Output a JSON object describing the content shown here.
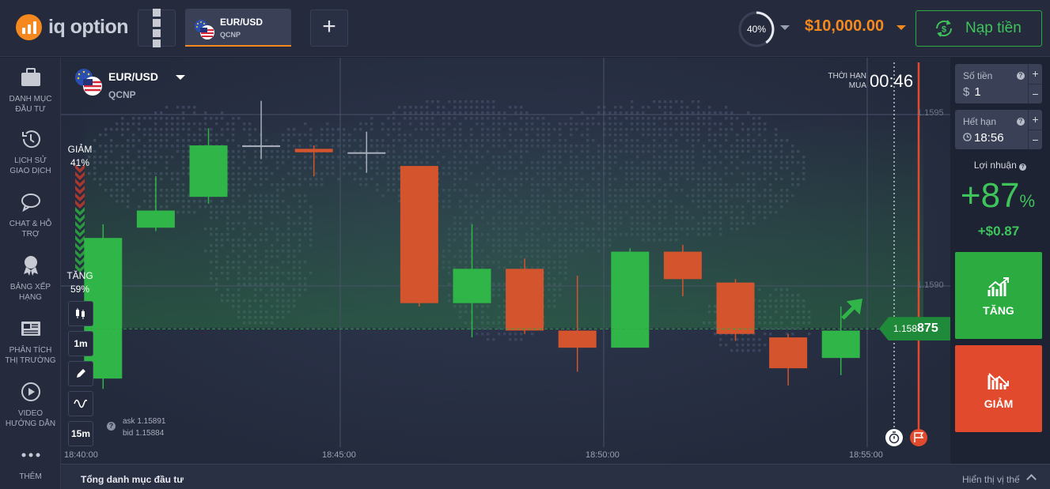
{
  "header": {
    "logo_text": "iq option",
    "asset_tab": {
      "pair": "EUR/USD",
      "type": "QCNP"
    },
    "payout_percent": "40%",
    "balance": "$10,000.00",
    "deposit_label": "Nạp tiền"
  },
  "sidebar": {
    "items": [
      {
        "label": "DANH MỤC ĐẦU TƯ",
        "icon": "briefcase-icon"
      },
      {
        "label": "LỊCH SỬ GIAO DỊCH",
        "icon": "history-icon"
      },
      {
        "label": "CHAT & HỖ TRỢ",
        "icon": "chat-icon"
      },
      {
        "label": "BẢNG XẾP HẠNG",
        "icon": "medal-icon"
      },
      {
        "label": "PHÂN TÍCH THỊ TRƯỜNG",
        "icon": "news-icon"
      },
      {
        "label": "VIDEO HƯỚNG DẪN",
        "icon": "play-icon"
      },
      {
        "label": "THÊM",
        "icon": "more-icon"
      }
    ]
  },
  "chart_panel": {
    "asset_name": "EUR/USD",
    "asset_type": "QCNP",
    "timer_label": "THỜI HẠN MUA",
    "timer_value": "00:46",
    "sentiment_down_label": "GIẢM",
    "sentiment_down_value": "41%",
    "sentiment_up_label": "TĂNG",
    "sentiment_up_value": "59%",
    "tools": [
      "1m",
      "15m"
    ],
    "ask": "ask 1.15891",
    "bid": "bid 1.15884",
    "current_price_prefix": "1.158",
    "current_price_suffix": "875"
  },
  "chart_data": {
    "type": "candlestick",
    "instrument": "EUR/USD",
    "y_tick_labels": [
      "1.1595",
      "1.1590"
    ],
    "x_tick_labels": [
      "18:40:00",
      "18:45:00",
      "18:50:00",
      "18:55:00"
    ],
    "ylim": [
      1.15833,
      1.15974
    ],
    "grid": true,
    "current_price": 1.158875,
    "candles": [
      {
        "time": "18:40:30",
        "open": 1.15873,
        "high": 1.15918,
        "low": 1.1587,
        "close": 1.15914,
        "color": "green"
      },
      {
        "time": "18:41:30",
        "open": 1.15917,
        "high": 1.15932,
        "low": 1.15916,
        "close": 1.15922,
        "color": "green"
      },
      {
        "time": "18:42:30",
        "open": 1.15926,
        "high": 1.15946,
        "low": 1.15924,
        "close": 1.15941,
        "color": "green"
      },
      {
        "time": "18:43:30",
        "open": 1.15941,
        "high": 1.15954,
        "low": 1.15937,
        "close": 1.15941,
        "color": "gray"
      },
      {
        "time": "18:44:30",
        "open": 1.1594,
        "high": 1.15941,
        "low": 1.15932,
        "close": 1.15939,
        "color": "red"
      },
      {
        "time": "18:45:30",
        "open": 1.15939,
        "high": 1.15945,
        "low": 1.15933,
        "close": 1.15939,
        "color": "gray"
      },
      {
        "time": "18:46:30",
        "open": 1.15935,
        "high": 1.15935,
        "low": 1.15894,
        "close": 1.15895,
        "color": "red"
      },
      {
        "time": "18:47:30",
        "open": 1.15895,
        "high": 1.15918,
        "low": 1.15885,
        "close": 1.15905,
        "color": "green"
      },
      {
        "time": "18:48:30",
        "open": 1.15905,
        "high": 1.15908,
        "low": 1.15886,
        "close": 1.15887,
        "color": "red"
      },
      {
        "time": "18:49:30",
        "open": 1.15887,
        "high": 1.15903,
        "low": 1.15875,
        "close": 1.15882,
        "color": "red"
      },
      {
        "time": "18:50:30",
        "open": 1.15882,
        "high": 1.15911,
        "low": 1.15882,
        "close": 1.1591,
        "color": "green"
      },
      {
        "time": "18:51:30",
        "open": 1.1591,
        "high": 1.15912,
        "low": 1.15897,
        "close": 1.15902,
        "color": "red"
      },
      {
        "time": "18:52:30",
        "open": 1.15901,
        "high": 1.15902,
        "low": 1.15884,
        "close": 1.15886,
        "color": "red"
      },
      {
        "time": "18:53:30",
        "open": 1.15885,
        "high": 1.15886,
        "low": 1.15871,
        "close": 1.15876,
        "color": "red"
      },
      {
        "time": "18:54:30",
        "open": 1.15879,
        "high": 1.15894,
        "low": 1.15874,
        "close": 1.15887,
        "color": "green"
      }
    ]
  },
  "trade_panel": {
    "amount_label": "Số tiền",
    "amount_currency": "$",
    "amount_value": "1",
    "expiry_label": "Hết hạn",
    "expiry_value": "18:56",
    "profit_label": "Lợi nhuận",
    "profit_percent": "+87",
    "profit_percent_sign": "%",
    "profit_amount": "+$0.87",
    "up_label": "TĂNG",
    "down_label": "GIẢM"
  },
  "footer": {
    "portfolio_label": "Tổng danh mục đầu tư",
    "show_positions_label": "Hiển thị vị thế"
  },
  "colors": {
    "accent": "#f5891f",
    "up": "#2bab40",
    "down": "#e24a2d",
    "candle_up": "#30b548",
    "candle_down": "#d4542e",
    "background": "#1e2333"
  }
}
